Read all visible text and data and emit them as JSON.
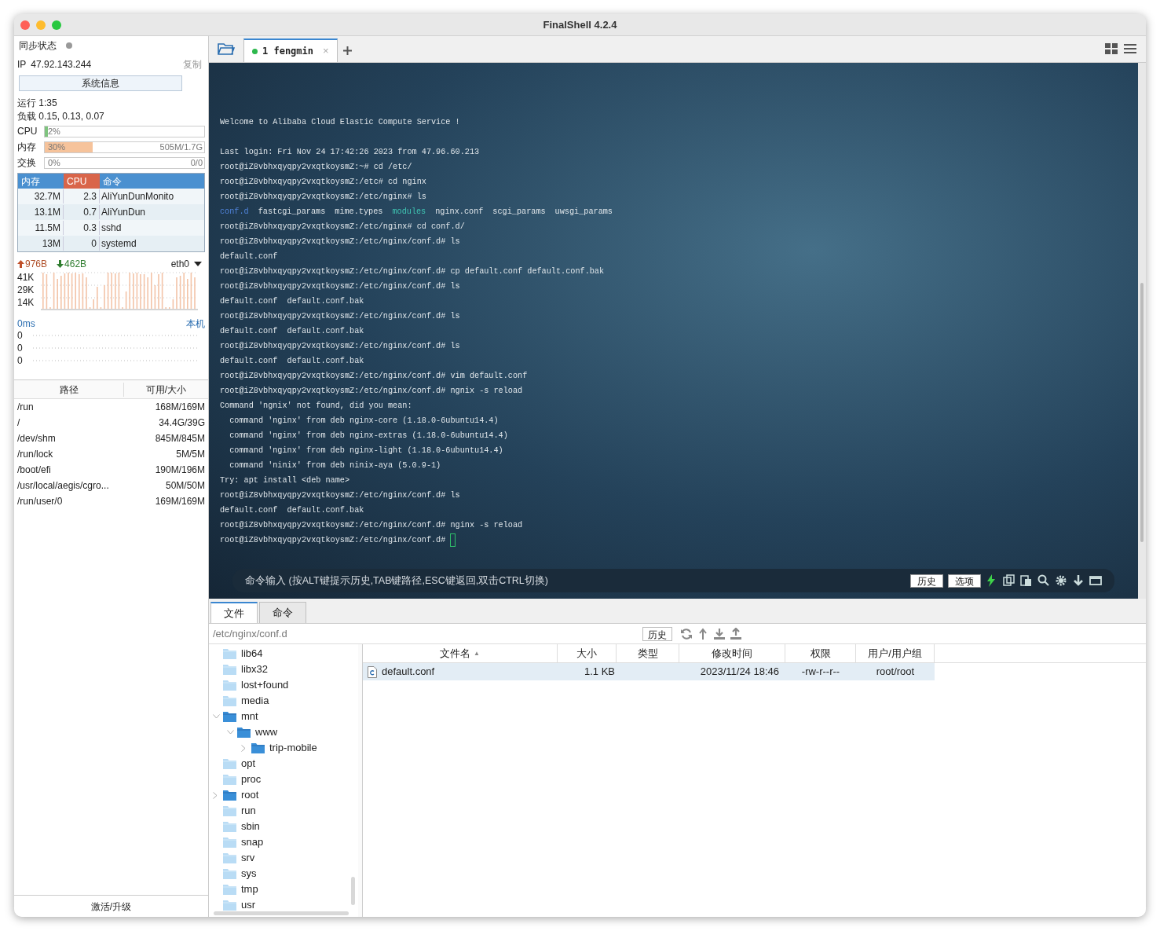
{
  "window": {
    "title": "FinalShell 4.2.4"
  },
  "sidebar": {
    "sync_label": "同步状态",
    "ip_label": "IP",
    "ip": "47.92.143.244",
    "copy": "复制",
    "sysinfo_button": "系统信息",
    "uptime": "运行 1:35",
    "load": "负载 0.15, 0.13, 0.07",
    "meters": [
      {
        "label": "CPU",
        "level": 0.02,
        "percent": "2%",
        "color": "#7fc47f"
      },
      {
        "label": "内存",
        "level": 0.3,
        "percent": "30%",
        "reading": "505M/1.7G",
        "color": "#f6c39b"
      },
      {
        "label": "交换",
        "percent": "0%",
        "reading": "0/0"
      }
    ],
    "process_columns": [
      {
        "label": "内存",
        "selected": false
      },
      {
        "label": "CPU",
        "selected": true
      },
      {
        "label": "命令",
        "selected": false
      }
    ],
    "processes": [
      [
        "32.7M",
        "2.3",
        "AliYunDunMonito"
      ],
      [
        "13.1M",
        "0.7",
        "AliYunDun"
      ],
      [
        "11.5M",
        "0.3",
        "sshd"
      ],
      [
        "13M",
        "0",
        "systemd"
      ]
    ],
    "net": {
      "up": "976B",
      "down": "462B",
      "interface": "eth0",
      "ticks": [
        "41K",
        "29K",
        "14K"
      ]
    },
    "ping": {
      "latency": "0ms",
      "host": "本机",
      "ticks": [
        "0",
        "0",
        "0"
      ]
    },
    "disk_columns": [
      "路径",
      "可用/大小"
    ],
    "disks": [
      [
        "/run",
        "168M/169M"
      ],
      [
        "/",
        "34.4G/39G"
      ],
      [
        "/dev/shm",
        "845M/845M"
      ],
      [
        "/run/lock",
        "5M/5M"
      ],
      [
        "/boot/efi",
        "190M/196M"
      ],
      [
        "/usr/local/aegis/cgro...",
        "50M/50M"
      ],
      [
        "/run/user/0",
        "169M/169M"
      ]
    ],
    "footer": "激活/升级"
  },
  "tabs": [
    {
      "index": "1",
      "label": "fengmin",
      "close": "×",
      "selected": true
    }
  ],
  "terminal": [
    {
      "kind": "banner",
      "text": "Welcome to Alibaba Cloud Elastic Compute Service !"
    },
    {
      "kind": "text",
      "text": "Last login: Fri Nov 24 17:42:26 2023 from 47.96.60.213"
    },
    {
      "kind": "text",
      "text": "root@iZ8vbhxqyqpy2vxqtkoysmZ:~# cd /etc/"
    },
    {
      "kind": "text",
      "text": "root@iZ8vbhxqyqpy2vxqtkoysmZ:/etc# cd nginx"
    },
    {
      "kind": "text",
      "text": "root@iZ8vbhxqyqpy2vxqtkoysmZ:/etc/nginx# ls"
    },
    {
      "kind": "listing",
      "items": [
        {
          "text": "conf.d",
          "kind": "directory"
        },
        {
          "text": "fastcgi_params",
          "kind": "file"
        },
        {
          "text": "mime.types",
          "kind": "file"
        },
        {
          "text": "modules",
          "kind": "link"
        },
        {
          "text": "nginx.conf",
          "kind": "file"
        },
        {
          "text": "scgi_params",
          "kind": "file"
        },
        {
          "text": "uwsgi_params",
          "kind": "file"
        }
      ]
    },
    {
      "kind": "text",
      "text": "root@iZ8vbhxqyqpy2vxqtkoysmZ:/etc/nginx# cd conf.d/"
    },
    {
      "kind": "text",
      "text": "root@iZ8vbhxqyqpy2vxqtkoysmZ:/etc/nginx/conf.d# ls"
    },
    {
      "kind": "text",
      "text": "default.conf"
    },
    {
      "kind": "text",
      "text": "root@iZ8vbhxqyqpy2vxqtkoysmZ:/etc/nginx/conf.d# cp default.conf default.conf.bak"
    },
    {
      "kind": "text",
      "text": "root@iZ8vbhxqyqpy2vxqtkoysmZ:/etc/nginx/conf.d# ls"
    },
    {
      "kind": "text",
      "text": "default.conf  default.conf.bak"
    },
    {
      "kind": "text",
      "text": "root@iZ8vbhxqyqpy2vxqtkoysmZ:/etc/nginx/conf.d# ls"
    },
    {
      "kind": "text",
      "text": "default.conf  default.conf.bak"
    },
    {
      "kind": "text",
      "text": "root@iZ8vbhxqyqpy2vxqtkoysmZ:/etc/nginx/conf.d# ls"
    },
    {
      "kind": "text",
      "text": "default.conf  default.conf.bak"
    },
    {
      "kind": "text",
      "text": "root@iZ8vbhxqyqpy2vxqtkoysmZ:/etc/nginx/conf.d# vim default.conf"
    },
    {
      "kind": "text",
      "text": "root@iZ8vbhxqyqpy2vxqtkoysmZ:/etc/nginx/conf.d# ngnix -s reload"
    },
    {
      "kind": "text",
      "text": "Command 'ngnix' not found, did you mean:"
    },
    {
      "kind": "text",
      "text": "  command 'nginx' from deb nginx-core (1.18.0-6ubuntu14.4)"
    },
    {
      "kind": "text",
      "text": "  command 'nginx' from deb nginx-extras (1.18.0-6ubuntu14.4)"
    },
    {
      "kind": "text",
      "text": "  command 'nginx' from deb nginx-light (1.18.0-6ubuntu14.4)"
    },
    {
      "kind": "text",
      "text": "  command 'ninix' from deb ninix-aya (5.0.9-1)"
    },
    {
      "kind": "text",
      "text": "Try: apt install <deb name>"
    },
    {
      "kind": "text",
      "text": "root@iZ8vbhxqyqpy2vxqtkoysmZ:/etc/nginx/conf.d# ls"
    },
    {
      "kind": "text",
      "text": "default.conf  default.conf.bak"
    },
    {
      "kind": "text",
      "text": "root@iZ8vbhxqyqpy2vxqtkoysmZ:/etc/nginx/conf.d# nginx -s reload"
    },
    {
      "kind": "prompt",
      "text": "root@iZ8vbhxqyqpy2vxqtkoysmZ:/etc/nginx/conf.d#"
    }
  ],
  "command_bar": {
    "placeholder": "命令输入 (按ALT键提示历史,TAB键路径,ESC键返回,双击CTRL切换)",
    "buttons": [
      "历史",
      "选项"
    ]
  },
  "file_panel": {
    "tabs": [
      {
        "label": "文件",
        "selected": true
      },
      {
        "label": "命令",
        "selected": false
      }
    ],
    "path": "/etc/nginx/conf.d",
    "history_button": "历史",
    "tree": [
      {
        "name": "lib64",
        "kind": "light"
      },
      {
        "name": "libx32",
        "kind": "light"
      },
      {
        "name": "lost+found",
        "kind": "light"
      },
      {
        "name": "media",
        "kind": "light"
      },
      {
        "name": "mnt",
        "kind": "dark",
        "expanded": true,
        "children": [
          {
            "name": "www",
            "kind": "dark",
            "expanded": true,
            "children": [
              {
                "name": "trip-mobile",
                "kind": "dark",
                "expanded": false
              }
            ]
          }
        ]
      },
      {
        "name": "opt",
        "kind": "light"
      },
      {
        "name": "proc",
        "kind": "light"
      },
      {
        "name": "root",
        "kind": "dark",
        "expanded": false
      },
      {
        "name": "run",
        "kind": "light"
      },
      {
        "name": "sbin",
        "kind": "light"
      },
      {
        "name": "snap",
        "kind": "light"
      },
      {
        "name": "srv",
        "kind": "light"
      },
      {
        "name": "sys",
        "kind": "light"
      },
      {
        "name": "tmp",
        "kind": "light"
      },
      {
        "name": "usr",
        "kind": "light"
      }
    ],
    "columns": [
      {
        "label": "文件名",
        "sort": "▲"
      },
      {
        "label": "大小"
      },
      {
        "label": "类型"
      },
      {
        "label": "修改时间"
      },
      {
        "label": "权限"
      },
      {
        "label": "用户/用户组"
      }
    ],
    "files": [
      {
        "name": "default.conf",
        "size": "1.1 KB",
        "modified": "2023/11/24 18:46",
        "perm": "-rw-r--r--",
        "owner": "root/root",
        "selected": true
      }
    ]
  }
}
